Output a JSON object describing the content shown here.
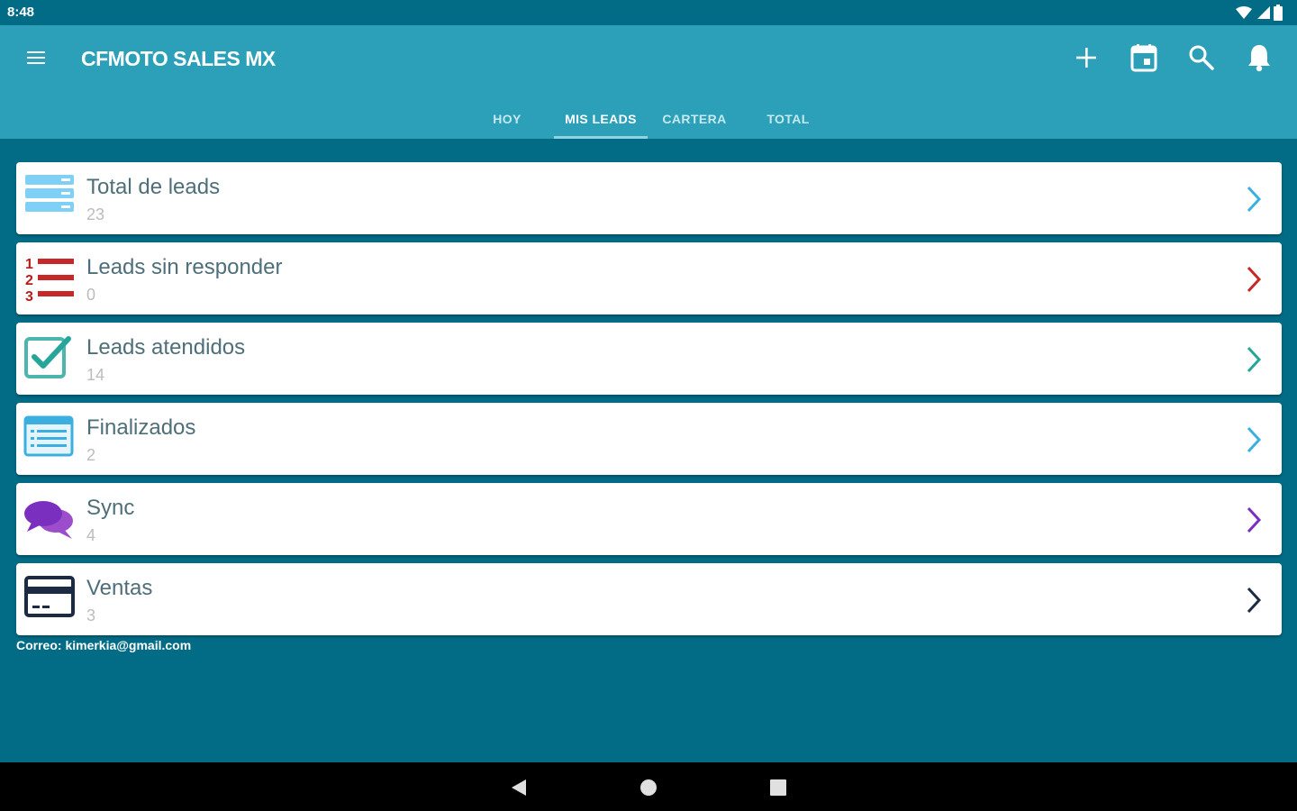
{
  "status": {
    "time": "8:48"
  },
  "app": {
    "title": "CFMOTO SALES MX"
  },
  "tabs": [
    {
      "label": "HOY",
      "active": false
    },
    {
      "label": "MIS LEADS",
      "active": true
    },
    {
      "label": "CARTERA",
      "active": false
    },
    {
      "label": "TOTAL",
      "active": false
    }
  ],
  "items": [
    {
      "title": "Total de leads",
      "count": "23",
      "icon": "server-list-icon",
      "chevron_color": "#3bb0e0"
    },
    {
      "title": "Leads sin responder",
      "count": "0",
      "icon": "numbered-list-icon",
      "chevron_color": "#c62828"
    },
    {
      "title": "Leads atendidos",
      "count": "14",
      "icon": "checkbox-icon",
      "chevron_color": "#26a69a"
    },
    {
      "title": "Finalizados",
      "count": "2",
      "icon": "document-list-icon",
      "chevron_color": "#3bb0e0"
    },
    {
      "title": "Sync",
      "count": "4",
      "icon": "chat-bubbles-icon",
      "chevron_color": "#7b2fbe"
    },
    {
      "title": "Ventas",
      "count": "3",
      "icon": "credit-card-icon",
      "chevron_color": "#1c2a44"
    }
  ],
  "footer": {
    "email_text": "Correo: kimerkia@gmail.com"
  },
  "colors": {
    "app_bar": "#2ba0b8",
    "background": "#026b85",
    "nav_bar": "#000000"
  }
}
